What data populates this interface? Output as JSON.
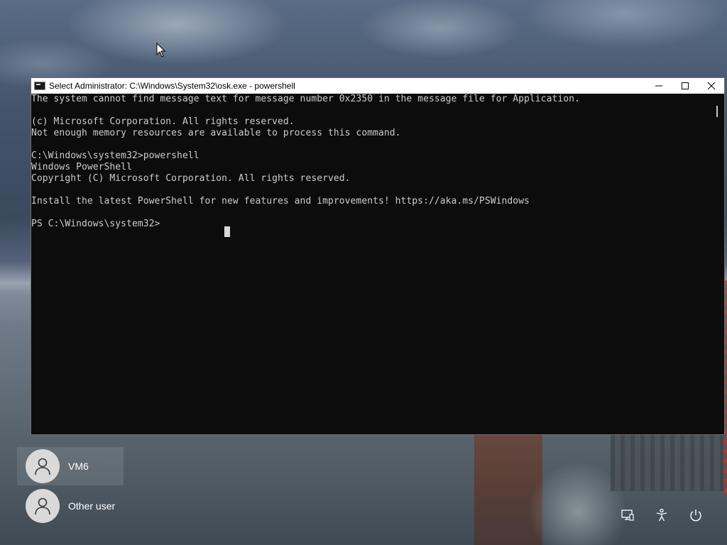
{
  "window": {
    "title": "Select Administrator: C:\\Windows\\System32\\osk.exe - powershell",
    "app_icon": "console-icon",
    "controls": [
      "minimize-icon",
      "maximize-icon",
      "close-icon"
    ]
  },
  "console": {
    "lines": [
      "The system cannot find message text for message number 0x2350 in the message file for Application.",
      "",
      "(c) Microsoft Corporation. All rights reserved.",
      "Not enough memory resources are available to process this command.",
      "",
      "C:\\Windows\\system32>powershell",
      "Windows PowerShell",
      "Copyright (C) Microsoft Corporation. All rights reserved.",
      "",
      "Install the latest PowerShell for new features and improvements! https://aka.ms/PSWindows",
      "",
      "PS C:\\Windows\\system32>"
    ]
  },
  "users": [
    {
      "name": "VM6",
      "icon": "user-avatar-icon",
      "selected": true
    },
    {
      "name": "Other user",
      "icon": "user-avatar-icon",
      "selected": false
    }
  ],
  "system_buttons": [
    "network-icon",
    "accessibility-icon",
    "power-icon"
  ],
  "colors": {
    "console_bg": "#0c0c0c",
    "console_text": "#cccccc",
    "titlebar_bg": "#ffffff"
  }
}
